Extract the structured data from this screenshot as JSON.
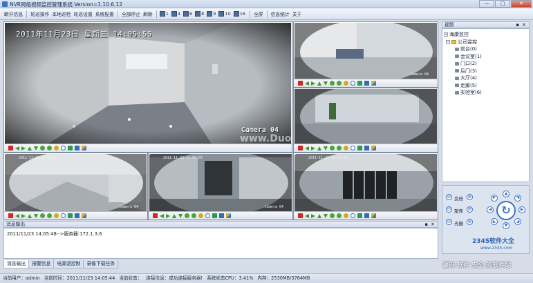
{
  "window": {
    "title": "NVR网络视频监控管理系统 Version=1.10.6.12",
    "minimize": "—",
    "maximize": "□",
    "close": "✕"
  },
  "toolbar": {
    "items": [
      "断开信息",
      "轮巡操作",
      "本地巡检",
      "轮巡设置",
      "系统配置",
      "全部停止",
      "刷新"
    ],
    "layouts": [
      "1",
      "4",
      "6",
      "8",
      "9",
      "10",
      "16"
    ],
    "fullscreen": "全屏",
    "tools": "信息统计",
    "about": "关于"
  },
  "cameras": {
    "main": {
      "date": "2011年11月23日",
      "weekday": "星期三",
      "time": "14:05:55",
      "label": "Camera 04"
    },
    "small_label": "Camera 04",
    "small_date": "2011-11-23 14:05:55"
  },
  "watermark": {
    "site": "www.DuoTe.com",
    "brand": "2345软件大全",
    "brand_url": "www.2345.com",
    "bottom": "源码 软件 安全 的软件站"
  },
  "tree_panel": {
    "title": "视频",
    "pin": "▪",
    "close": "✕",
    "root": "海康监控",
    "group": "公司监控",
    "nodes": [
      "前台(0)",
      "会议室(1)",
      "门口(2)",
      "后门(3)",
      "大厅(4)",
      "走廊(5)",
      "实验室(6)"
    ]
  },
  "ptz": {
    "zoom_in": "⊖",
    "zoom_out": "⊕",
    "labels": [
      "变倍",
      "聚焦",
      "光圈"
    ],
    "center": "↻"
  },
  "message_panel": {
    "title": "消息输出",
    "pin": "▪",
    "close": "✕",
    "line": "2011/11/23 14:05:48-->服务器:172.1.3.6"
  },
  "tabs": [
    "消息输出",
    "报警信息",
    "电源滤控制",
    "录像下载任务"
  ],
  "status": {
    "user": "当前用户：admin",
    "time": "当前时间：2011/11/23 14:05:44",
    "state": "当前状态：",
    "conn": "连接信息：成功连接服务器!",
    "cpu": "系统状态CPU：3.41%",
    "mem": "内存：2530MB/3764MB"
  },
  "colors": {
    "accent": "#3a73c4",
    "stop": "#d02a20",
    "play": "#3a9a2a",
    "panel": "#d6dde8"
  }
}
